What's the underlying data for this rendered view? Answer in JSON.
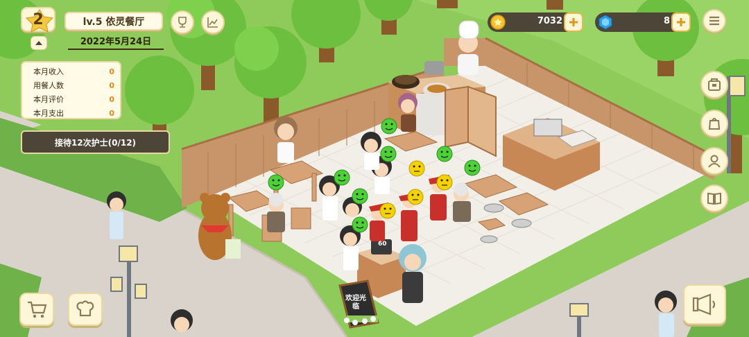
{
  "hud": {
    "level": "2",
    "restaurant_name": "lv.5 依灵餐厅",
    "date": "2022年5月24日"
  },
  "stats": [
    {
      "label": "本月收入",
      "value": "0"
    },
    {
      "label": "用餐人数",
      "value": "0"
    },
    {
      "label": "本月评价",
      "value": "0"
    },
    {
      "label": "本月支出",
      "value": "0"
    }
  ],
  "quest": {
    "label": "接待12次护士(0/12)"
  },
  "currency": {
    "coins": "7032",
    "gems": "8"
  },
  "scene": {
    "welcome_sign": "欢迎光临",
    "counter_number": "60"
  },
  "icons": {
    "trophy": "trophy-icon",
    "chart": "chart-icon",
    "menu": "menu-icon",
    "coin": "coin-icon",
    "gem": "gem-icon",
    "cart": "shopping-cart-icon",
    "chef_hat": "chef-hat-icon",
    "megaphone": "megaphone-icon"
  },
  "colors": {
    "hud_cream": "#fdf6d8",
    "hud_dark": "#4d4538",
    "stat_value": "#e68a17",
    "grass": "#8fcb5a"
  }
}
